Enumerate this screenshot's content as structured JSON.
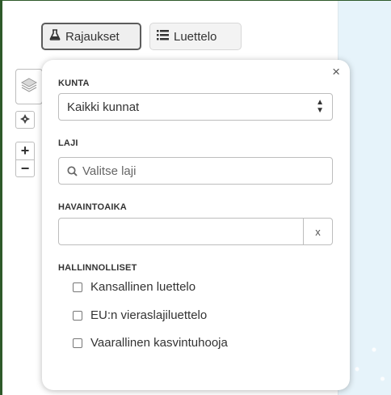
{
  "toolbar": {
    "filters_label": "Rajaukset",
    "list_label": "Luettelo",
    "filters_icon": "flask-icon",
    "list_icon": "list-icon"
  },
  "map_controls": {
    "layers_icon": "layers-icon",
    "locate_icon": "locate-icon",
    "zoom_in": "+",
    "zoom_out": "−"
  },
  "filter_panel": {
    "close_glyph": "×",
    "municipality": {
      "label": "KUNTA",
      "selected": "Kaikki kunnat"
    },
    "species": {
      "label": "LAJI",
      "placeholder": "Valitse laji"
    },
    "observation_date": {
      "label": "HAVAINTOAIKA",
      "value": "",
      "clear_label": "x"
    },
    "administrative": {
      "label": "HALLINNOLLISET",
      "options": [
        {
          "label": "Kansallinen luettelo",
          "checked": false
        },
        {
          "label": "EU:n vieraslajiluettelo",
          "checked": false
        },
        {
          "label": "Vaarallinen kasvintuhooja",
          "checked": false
        }
      ]
    }
  },
  "colors": {
    "frame_border": "#2e5a2a",
    "map_water": "#e6f3fa"
  }
}
